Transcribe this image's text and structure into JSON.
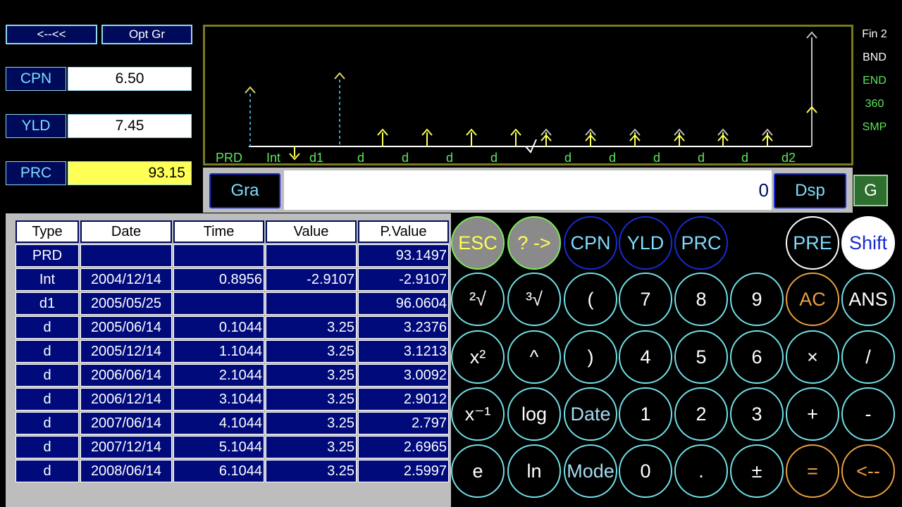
{
  "toolbar": {
    "back_label": "<--<<",
    "opt_label": "Opt Gr"
  },
  "params": [
    {
      "label": "CPN",
      "value": "6.50"
    },
    {
      "label": "YLD",
      "value": "7.45"
    },
    {
      "label": "PRC",
      "value": "93.15"
    }
  ],
  "status": [
    "Fin 2",
    "BND",
    "END",
    "360",
    "SMP"
  ],
  "graph": {
    "labels": [
      "PRD",
      "Int",
      "d1",
      "d",
      "d",
      "d",
      "d",
      "d",
      "d",
      "d",
      "d",
      "d",
      "d",
      "d2"
    ]
  },
  "display": {
    "gra_label": "Gra",
    "value": "0",
    "dsp_label": "Dsp",
    "g_label": "G"
  },
  "table": {
    "headers": [
      "Type",
      "Date",
      "Time",
      "Value",
      "P.Value"
    ],
    "rows": [
      [
        "PRD",
        "",
        "",
        "",
        "93.1497"
      ],
      [
        "Int",
        "2004/12/14",
        "0.8956",
        "-2.9107",
        "-2.9107"
      ],
      [
        "d1",
        "2005/05/25",
        "",
        "",
        "96.0604"
      ],
      [
        "d",
        "2005/06/14",
        "0.1044",
        "3.25",
        "3.2376"
      ],
      [
        "d",
        "2005/12/14",
        "1.1044",
        "3.25",
        "3.1213"
      ],
      [
        "d",
        "2006/06/14",
        "2.1044",
        "3.25",
        "3.0092"
      ],
      [
        "d",
        "2006/12/14",
        "3.1044",
        "3.25",
        "2.9012"
      ],
      [
        "d",
        "2007/06/14",
        "4.1044",
        "3.25",
        "2.797"
      ],
      [
        "d",
        "2007/12/14",
        "5.1044",
        "3.25",
        "2.6965"
      ],
      [
        "d",
        "2008/06/14",
        "6.1044",
        "3.25",
        "2.5997"
      ]
    ]
  },
  "keypad": {
    "keys": [
      [
        "ESC",
        "? ->",
        "CPN",
        "YLD",
        "PRC",
        "",
        "PRE",
        "Shift"
      ],
      [
        "²√",
        "³√",
        "(",
        "7",
        "8",
        "9",
        "AC",
        "ANS"
      ],
      [
        "x²",
        "^",
        ")",
        "4",
        "5",
        "6",
        "×",
        "/"
      ],
      [
        "x⁻¹",
        "log",
        "Date",
        "1",
        "2",
        "3",
        "+",
        "-"
      ],
      [
        "e",
        "ln",
        "Mode",
        "0",
        ".",
        "±",
        "=",
        "<--"
      ]
    ]
  }
}
